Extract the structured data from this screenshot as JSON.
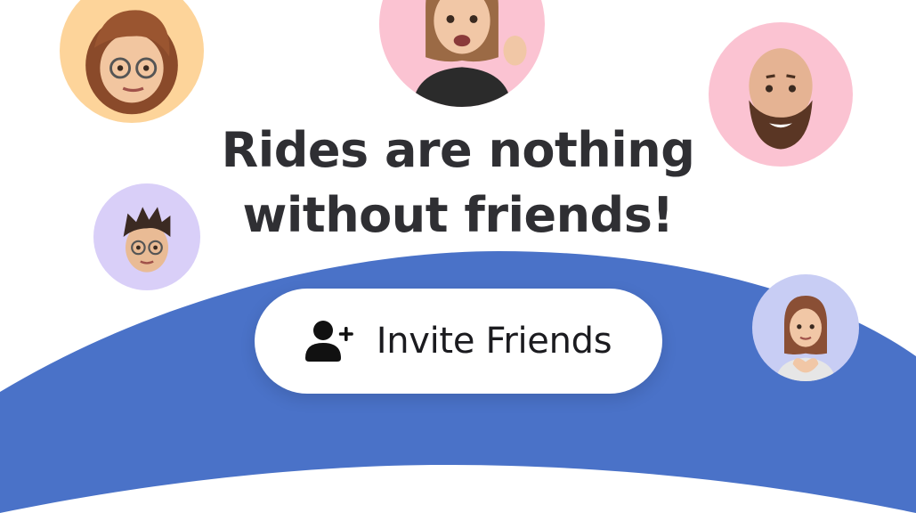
{
  "headline": {
    "line1": "Rides are nothing",
    "line2": "without friends!"
  },
  "invite_button": {
    "label": "Invite Friends",
    "icon": "add-person-icon"
  },
  "avatars": [
    {
      "name": "avatar-curly-hair-glasses",
      "bg": "#fdd49a"
    },
    {
      "name": "avatar-waving-woman",
      "bg": "#fbc3d2"
    },
    {
      "name": "avatar-bearded-man",
      "bg": "#fbc3d2"
    },
    {
      "name": "avatar-spiky-hair-glasses",
      "bg": "#d9cff8"
    },
    {
      "name": "avatar-heart-hands",
      "bg": "#c8cdf4"
    }
  ],
  "colors": {
    "background": "#ffffff",
    "wave": "#4a72c8",
    "headline": "#2f2f33",
    "button_bg": "#ffffff",
    "button_text": "#1b1b1f"
  }
}
